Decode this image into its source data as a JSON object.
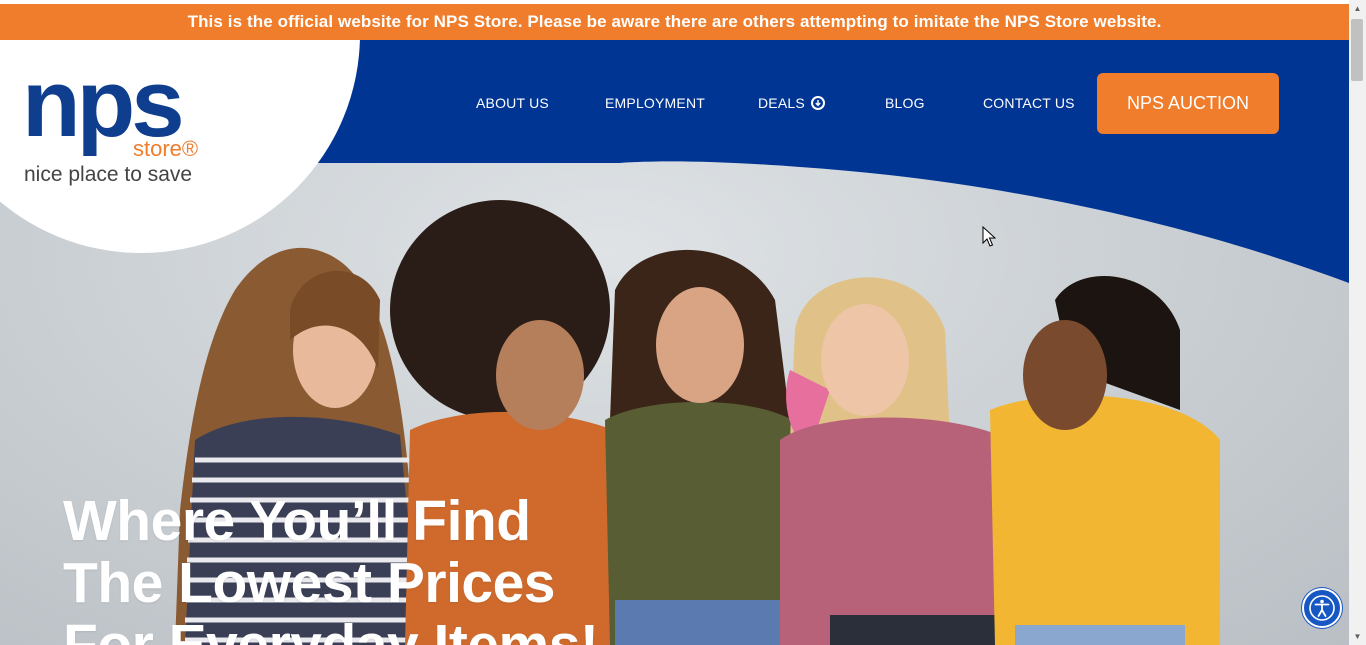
{
  "banner": {
    "text": "This is the official website for NPS Store. Please be aware there are others attempting to imitate the NPS Store website."
  },
  "logo": {
    "wordmark": "nps",
    "store": "store®",
    "tagline": "nice place to save"
  },
  "nav": {
    "items": [
      {
        "label": "ABOUT US"
      },
      {
        "label": "EMPLOYMENT"
      },
      {
        "label": "DEALS"
      },
      {
        "label": "BLOG"
      },
      {
        "label": "CONTACT US"
      }
    ],
    "auction_label": "NPS AUCTION"
  },
  "hero": {
    "headline_lines": [
      "Where You’ll Find",
      "The Lowest Prices",
      "For Everyday Items!"
    ]
  },
  "colors": {
    "navy": "#003594",
    "orange": "#ef7d2b",
    "logo_blue": "#0f3e8f",
    "accessibility_blue": "#1757c4"
  },
  "icons": {
    "deals": "arrow-down-circle-icon",
    "accessibility": "accessibility-icon"
  }
}
